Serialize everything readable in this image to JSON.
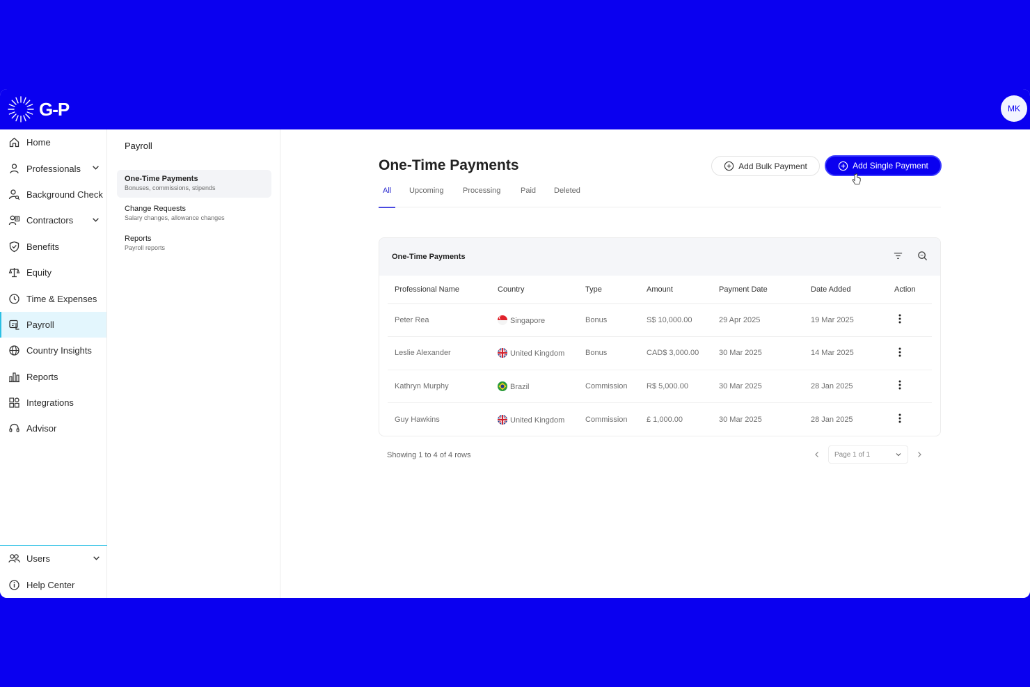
{
  "brand": {
    "logo_text": "G-P"
  },
  "user": {
    "initials": "MK"
  },
  "sidebar": {
    "items": [
      {
        "label": "Home",
        "icon": "home-icon"
      },
      {
        "label": "Professionals",
        "icon": "person-icon",
        "expandable": true
      },
      {
        "label": "Background Check",
        "icon": "person-search-icon"
      },
      {
        "label": "Contractors",
        "icon": "contractor-icon",
        "expandable": true
      },
      {
        "label": "Benefits",
        "icon": "shield-icon"
      },
      {
        "label": "Equity",
        "icon": "scale-icon"
      },
      {
        "label": "Time & Expenses",
        "icon": "clock-icon"
      },
      {
        "label": "Payroll",
        "icon": "payroll-icon",
        "active": true
      },
      {
        "label": "Country Insights",
        "icon": "globe-icon"
      },
      {
        "label": "Reports",
        "icon": "chart-icon"
      },
      {
        "label": "Integrations",
        "icon": "integrations-icon"
      },
      {
        "label": "Advisor",
        "icon": "headset-icon"
      }
    ],
    "bottom": [
      {
        "label": "Users",
        "icon": "users-icon",
        "expandable": true
      },
      {
        "label": "Help Center",
        "icon": "info-icon"
      }
    ]
  },
  "subnav": {
    "title": "Payroll",
    "items": [
      {
        "title": "One-Time Payments",
        "subtitle": "Bonuses, commissions, stipends",
        "active": true
      },
      {
        "title": "Change Requests",
        "subtitle": "Salary changes, allowance changes"
      },
      {
        "title": "Reports",
        "subtitle": "Payroll reports"
      }
    ]
  },
  "main": {
    "title": "One-Time Payments",
    "buttons": {
      "bulk": "Add Bulk Payment",
      "single": "Add Single Payment"
    },
    "tabs": [
      "All",
      "Upcoming",
      "Processing",
      "Paid",
      "Deleted"
    ],
    "active_tab": "All",
    "card_title": "One-Time Payments",
    "columns": [
      "Professional Name",
      "Country",
      "Type",
      "Amount",
      "Payment Date",
      "Date Added",
      "Action"
    ],
    "rows": [
      {
        "name": "Peter Rea",
        "country": "Singapore",
        "flag": "sg",
        "type": "Bonus",
        "amount": "S$ 10,000.00",
        "payment_date": "29 Apr 2025",
        "date_added": "19 Mar 2025"
      },
      {
        "name": "Leslie Alexander",
        "country": "United Kingdom",
        "flag": "uk",
        "type": "Bonus",
        "amount": "CAD$ 3,000.00",
        "payment_date": "30 Mar 2025",
        "date_added": "14 Mar 2025"
      },
      {
        "name": "Kathryn Murphy",
        "country": "Brazil",
        "flag": "br",
        "type": "Commission",
        "amount": "R$ 5,000.00",
        "payment_date": "30 Mar 2025",
        "date_added": "28 Jan 2025"
      },
      {
        "name": "Guy Hawkins",
        "country": "United Kingdom",
        "flag": "uk",
        "type": "Commission",
        "amount": "£ 1,000.00",
        "payment_date": "30 Mar 2025",
        "date_added": "28 Jan 2025"
      }
    ],
    "footer": "Showing 1 to 4 of 4 rows",
    "pager": "Page 1 of 1"
  },
  "colors": {
    "brand": "#0a00f0",
    "active_bg": "#e3f6fd",
    "accent": "#2bc0e4"
  }
}
